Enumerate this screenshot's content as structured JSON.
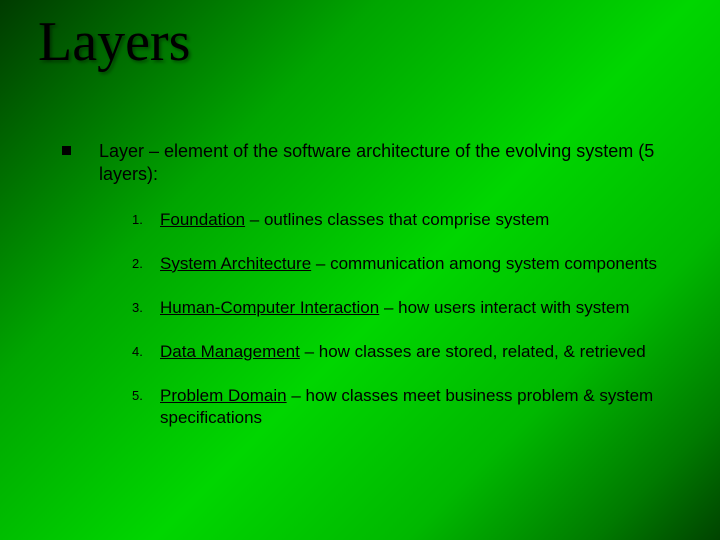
{
  "title": "Layers",
  "intro": "Layer – element of the software architecture of the evolving system (5 layers):",
  "items": [
    {
      "num": "1.",
      "term": "Foundation",
      "rest": " – outlines classes that comprise system"
    },
    {
      "num": "2.",
      "term": "System Architecture",
      "rest": " – communication among system components"
    },
    {
      "num": "3.",
      "term": "Human-Computer Interaction",
      "rest": " – how users interact with system"
    },
    {
      "num": "4.",
      "term": "Data Management",
      "rest": " – how classes are stored, related, & retrieved"
    },
    {
      "num": "5.",
      "term": "Problem Domain",
      "rest": " – how classes meet business problem & system specifications"
    }
  ]
}
